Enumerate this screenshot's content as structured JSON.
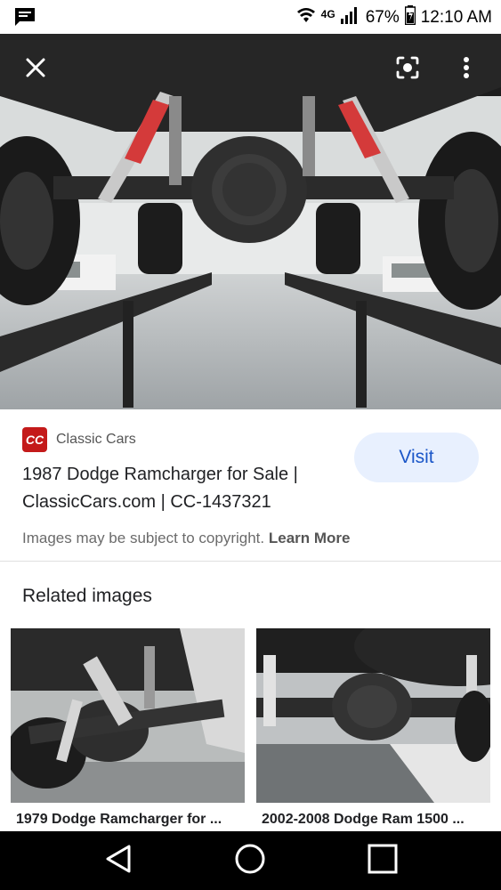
{
  "status_bar": {
    "battery_percent": "67%",
    "time": "12:10 AM",
    "network": "4G"
  },
  "hero": {
    "icons": [
      "close-icon",
      "lens-icon",
      "more-vert-icon"
    ]
  },
  "result": {
    "source_name": "Classic Cars",
    "favicon_text": "CC",
    "title": "1987 Dodge Ramcharger for Sale | ClassicCars.com | CC-1437321",
    "visit_label": "Visit",
    "copyright_text": "Images may be subject to copyright.",
    "learn_more_label": "Learn More"
  },
  "related": {
    "heading": "Related images",
    "items": [
      {
        "caption": "1979 Dodge Ramcharger for ..."
      },
      {
        "caption": "2002-2008 Dodge Ram 1500 ..."
      }
    ]
  },
  "nav": {
    "icons": [
      "back-icon",
      "home-icon",
      "recents-icon"
    ]
  }
}
